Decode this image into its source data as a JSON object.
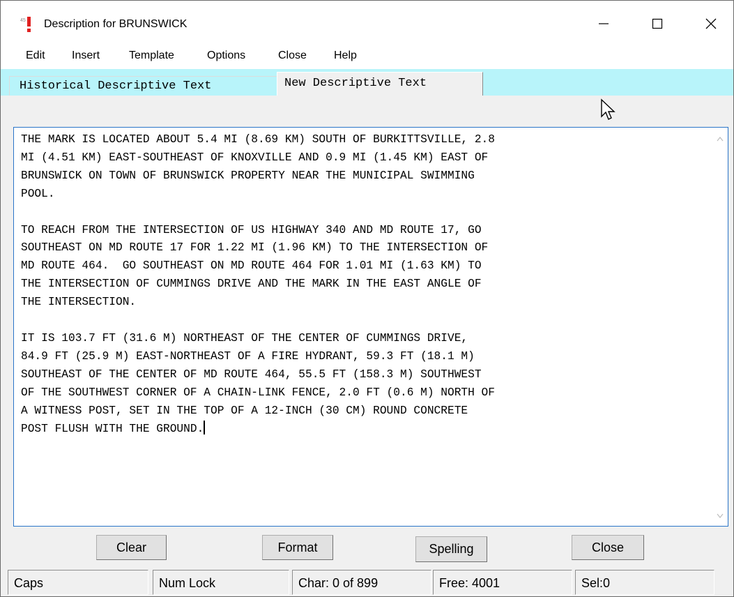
{
  "window": {
    "title": "Description for BRUNSWICK"
  },
  "menubar": {
    "items": [
      "Edit",
      "Insert",
      "Template",
      "Options",
      "Close",
      "Help"
    ]
  },
  "tabs": [
    {
      "label": "Historical Descriptive Text",
      "active": false
    },
    {
      "label": "New Descriptive Text",
      "active": true
    }
  ],
  "editor": {
    "paragraphs": [
      "THE MARK IS LOCATED ABOUT 5.4 MI (8.69 KM) SOUTH OF BURKITTSVILLE, 2.8\nMI (4.51 KM) EAST-SOUTHEAST OF KNOXVILLE AND 0.9 MI (1.45 KM) EAST OF\nBRUNSWICK ON TOWN OF BRUNSWICK PROPERTY NEAR THE MUNICIPAL SWIMMING\nPOOL.",
      "TO REACH FROM THE INTERSECTION OF US HIGHWAY 340 AND MD ROUTE 17, GO\nSOUTHEAST ON MD ROUTE 17 FOR 1.22 MI (1.96 KM) TO THE INTERSECTION OF\nMD ROUTE 464.  GO SOUTHEAST ON MD ROUTE 464 FOR 1.01 MI (1.63 KM) TO\nTHE INTERSECTION OF CUMMINGS DRIVE AND THE MARK IN THE EAST ANGLE OF\nTHE INTERSECTION.",
      "IT IS 103.7 FT (31.6 M) NORTHEAST OF THE CENTER OF CUMMINGS DRIVE,\n84.9 FT (25.9 M) EAST-NORTHEAST OF A FIRE HYDRANT, 59.3 FT (18.1 M)\nSOUTHEAST OF THE CENTER OF MD ROUTE 464, 55.5 FT (158.3 M) SOUTHWEST\nOF THE SOUTHWEST CORNER OF A CHAIN-LINK FENCE, 2.0 FT (0.6 M) NORTH OF\nA WITNESS POST, SET IN THE TOP OF A 12-INCH (30 CM) ROUND CONCRETE\nPOST FLUSH WITH THE GROUND."
    ]
  },
  "buttons": {
    "clear": "Clear",
    "format": "Format",
    "spelling": "Spelling",
    "close": "Close"
  },
  "statusbar": {
    "caps": "Caps",
    "numlock": "Num Lock",
    "char": "Char: 0 of 899",
    "free": "Free: 4001",
    "sel": "Sel:0"
  },
  "colors": {
    "tab_strip": "#b8f4fa",
    "editor_border": "#2a75c8",
    "app_icon_accent": "#e02020"
  }
}
